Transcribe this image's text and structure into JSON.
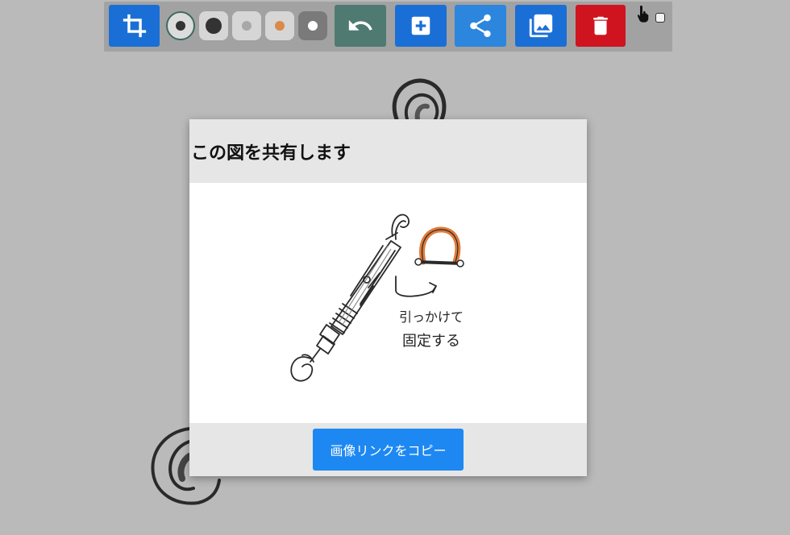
{
  "toolbar": {
    "buttons": [
      {
        "name": "crop",
        "icon": "crop-icon",
        "color": "#1a6fd6"
      },
      {
        "name": "undo",
        "icon": "undo-icon",
        "color": "#4e7a72"
      },
      {
        "name": "add",
        "icon": "plus-box-icon",
        "color": "#1a6fd6"
      },
      {
        "name": "share",
        "icon": "share-icon",
        "color": "#2c86dd"
      },
      {
        "name": "gallery",
        "icon": "image-library-icon",
        "color": "#1a6fd6"
      },
      {
        "name": "delete",
        "icon": "trash-icon",
        "color": "#cf1420"
      }
    ],
    "pens": [
      {
        "name": "pen-thin-dark",
        "color": "#333333",
        "selected": true
      },
      {
        "name": "pen-thick-dark",
        "color": "#333333"
      },
      {
        "name": "pen-gray",
        "color": "#a8a8a8"
      },
      {
        "name": "pen-orange",
        "color": "#d98a4a"
      },
      {
        "name": "eraser-white",
        "color": "#ffffff"
      }
    ],
    "touch_icon": "pointing-hand-icon",
    "touch_checkbox_checked": false
  },
  "dialog": {
    "title": "この図を共有します",
    "image_annotation_line1": "引っかけて",
    "image_annotation_line2": "固定する",
    "copy_button_label": "画像リンクをコピー"
  }
}
